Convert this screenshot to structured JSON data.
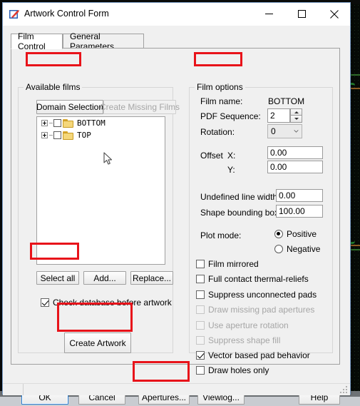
{
  "window": {
    "title": "Artwork Control Form",
    "icon": "artwork-app-icon",
    "minimize_label": "Minimize",
    "maximize_label": "Maximize",
    "close_label": "Close"
  },
  "tabs": [
    {
      "label": "Film Control",
      "active": true
    },
    {
      "label": "General Parameters",
      "active": false
    }
  ],
  "films_group": {
    "legend": "Available films",
    "domain_selection_button": "Domain Selection",
    "create_missing_films_button": "Create Missing Films",
    "tree": [
      {
        "label": "BOTTOM",
        "checked": false,
        "expanded": false,
        "icon": "folder-icon"
      },
      {
        "label": "TOP",
        "checked": false,
        "expanded": false,
        "icon": "folder-icon"
      }
    ],
    "select_all_button": "Select all",
    "add_button": "Add...",
    "replace_button": "Replace...",
    "check_database_label": "Check database before artwork",
    "check_database_checked": true,
    "create_artwork_button": "Create Artwork"
  },
  "film_options": {
    "legend": "Film options",
    "film_name_label": "Film name:",
    "film_name_value": "BOTTOM",
    "pdf_sequence_label": "PDF Sequence:",
    "pdf_sequence_value": "2",
    "rotation_label": "Rotation:",
    "rotation_value": "0",
    "offset_label": "Offset",
    "offset_x_label": "X:",
    "offset_x_value": "0.00",
    "offset_y_label": "Y:",
    "offset_y_value": "0.00",
    "undefined_line_width_label": "Undefined line width:",
    "undefined_line_width_value": "0.00",
    "shape_bounding_box_label": "Shape bounding box:",
    "shape_bounding_box_value": "100.00",
    "plot_mode_label": "Plot mode:",
    "plot_mode_positive": "Positive",
    "plot_mode_negative": "Negative",
    "plot_mode_selected": "Positive",
    "checkboxes": [
      {
        "label": "Film mirrored",
        "checked": false,
        "disabled": false
      },
      {
        "label": "Full contact thermal-reliefs",
        "checked": false,
        "disabled": false
      },
      {
        "label": "Suppress unconnected pads",
        "checked": false,
        "disabled": false
      },
      {
        "label": "Draw missing pad apertures",
        "checked": false,
        "disabled": true
      },
      {
        "label": "Use aperture rotation",
        "checked": false,
        "disabled": true
      },
      {
        "label": "Suppress shape fill",
        "checked": false,
        "disabled": true
      },
      {
        "label": "Vector based pad behavior",
        "checked": true,
        "disabled": false
      },
      {
        "label": "Draw holes only",
        "checked": false,
        "disabled": false
      }
    ]
  },
  "dialog_buttons": {
    "ok": "OK",
    "cancel": "Cancel",
    "apertures": "Apertures...",
    "viewlog": "Viewlog...",
    "help": "Help"
  },
  "annotations": {
    "highlight_color": "#e8131a",
    "highlighted": [
      "Available films",
      "Film options",
      "Select all",
      "Create Artwork",
      "Apertures..."
    ]
  },
  "colors": {
    "window_bg": "#f0f0f0",
    "titlebar_bg": "#ffffff",
    "window_border": "#7a9cc6",
    "accent_focus": "#2a7fd4",
    "folder_yellow": "#f5d77a",
    "pcb_green": "#1f7a2b"
  },
  "backdrop": {
    "ghost_text": ""
  }
}
